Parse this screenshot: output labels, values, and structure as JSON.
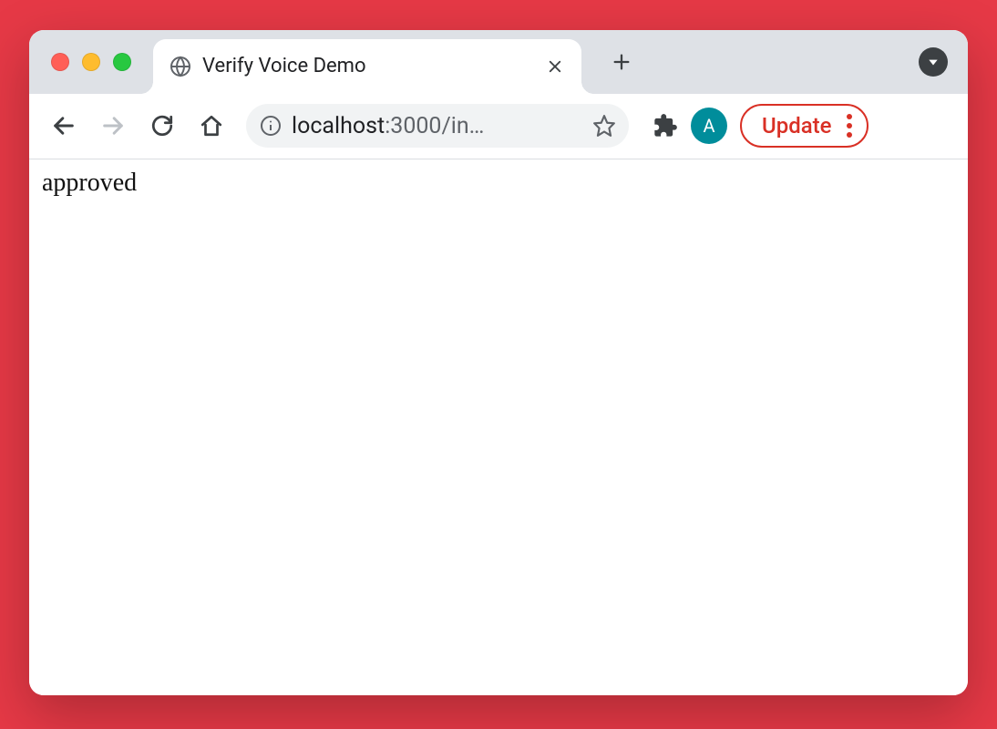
{
  "tab": {
    "title": "Verify Voice Demo"
  },
  "address": {
    "host": "localhost",
    "truncated_path": ":3000/in…"
  },
  "profile": {
    "initial": "A"
  },
  "update": {
    "label": "Update"
  },
  "page": {
    "body_text": "approved"
  }
}
